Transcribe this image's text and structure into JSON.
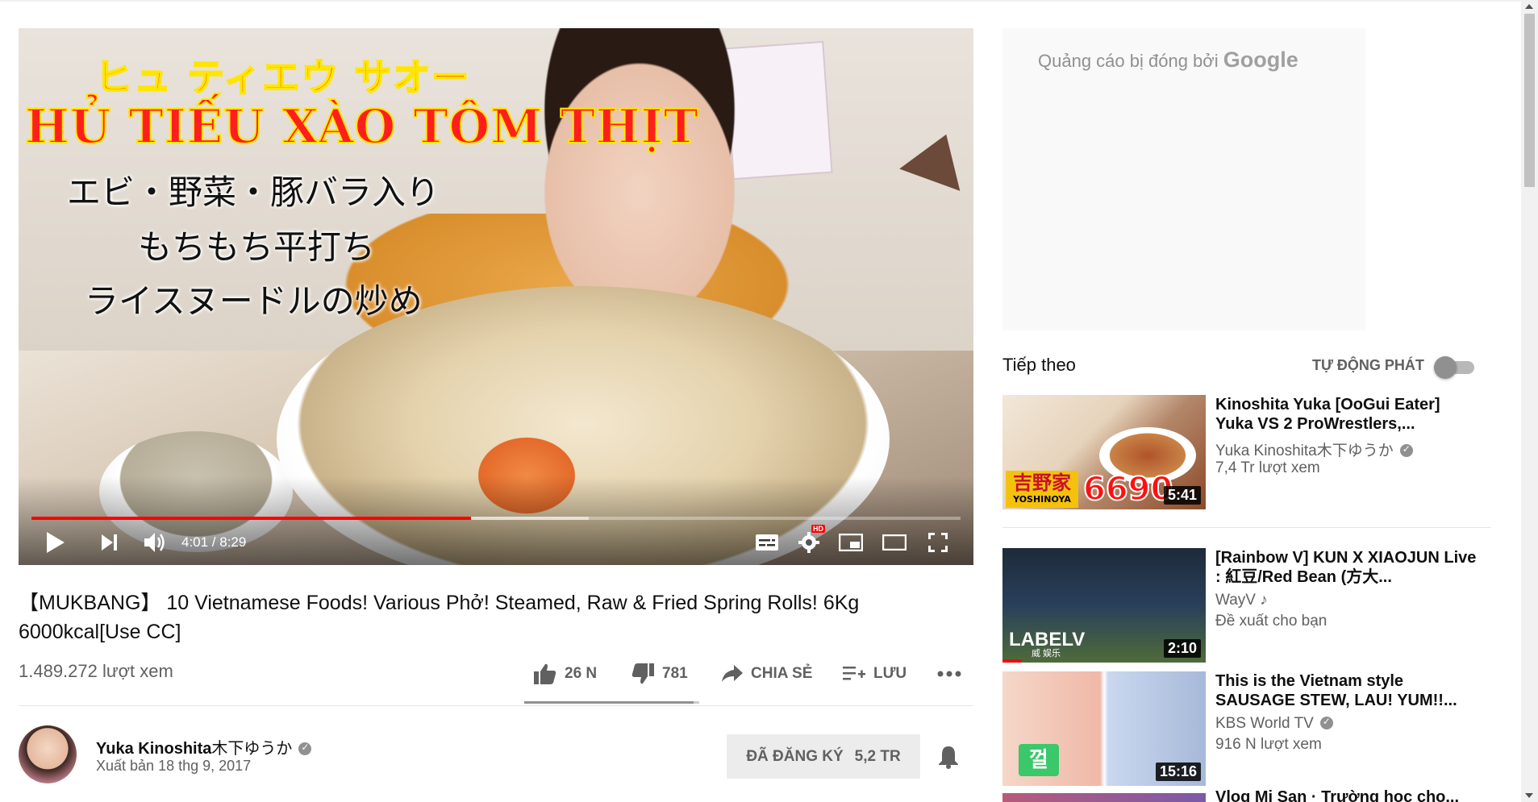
{
  "player": {
    "overlay_jp_title": "ヒュ ティエウ サオー",
    "overlay_vn_title": "HỦ TIẾU XÀO TÔM THỊT",
    "overlay_line1": "エビ・野菜・豚バラ入り",
    "overlay_line2": "もちもち平打ち",
    "overlay_line3": "ライスヌードルの炒め",
    "time_display": "4:01 / 8:29",
    "progress_fraction": 0.473,
    "buffered_fraction": 0.6,
    "hd_badge": "HD",
    "icons": [
      "play-icon",
      "next-icon",
      "volume-icon",
      "subtitles-icon",
      "settings-gear-icon",
      "miniplayer-icon",
      "theater-mode-icon",
      "fullscreen-icon"
    ]
  },
  "video": {
    "title": "【MUKBANG】 10 Vietnamese Foods! Various Phở! Steamed, Raw & Fried Spring Rolls! 6Kg 6000kcal[Use CC]",
    "views": "1.489.272 lượt xem",
    "like_count": "26 N",
    "dislike_count": "781",
    "share_label": "CHIA SẺ",
    "save_label": "LƯU",
    "like_ratio": 0.97
  },
  "owner": {
    "name": "Yuka Kinoshita",
    "name_jp": "木下ゆうか",
    "published": "Xuất bản 18 thg 9, 2017",
    "subscribe_label": "ĐÃ ĐĂNG KÝ",
    "subscriber_count": "5,2 TR"
  },
  "ad": {
    "closed_text": "Quảng cáo bị đóng bởi",
    "brand": "Google"
  },
  "sidebar": {
    "up_next": "Tiếp theo",
    "autoplay_label": "TỰ ĐỘNG PHÁT",
    "autoplay_on": false,
    "items": [
      {
        "title": "Kinoshita Yuka [OoGui Eater] Yuka VS 2 ProWrestlers,...",
        "channel": "Yuka Kinoshita木下ゆうか",
        "meta": "7,4 Tr lượt xem",
        "duration": "5:41",
        "thumb_logo": "吉野家",
        "thumb_logo_sub": "YOSHINOYA",
        "thumb_big": "6690"
      },
      {
        "title": "[Rainbow V] KUN X XIAOJUN Live : 紅豆/Red Bean (方大...",
        "channel": "WayV",
        "meta": "Đề xuất cho bạn",
        "duration": "2:10",
        "thumb_logo": "LABELV",
        "thumb_logo_sub": "威 娱乐"
      },
      {
        "title": "This is the Vietnam style SAUSAGE STEW, LAU! YUM!!...",
        "channel": "KBS World TV",
        "meta": "916 N lượt xem",
        "duration": "15:16",
        "thumb_logo": "껄"
      }
    ],
    "next_peek_title": "Vlog Mi San · Trường học cho..."
  },
  "colors": {
    "progress_red": "#ff0000",
    "text_primary": "#0f0f0f",
    "text_secondary": "#606060",
    "subscribe_bg": "#ececec"
  }
}
